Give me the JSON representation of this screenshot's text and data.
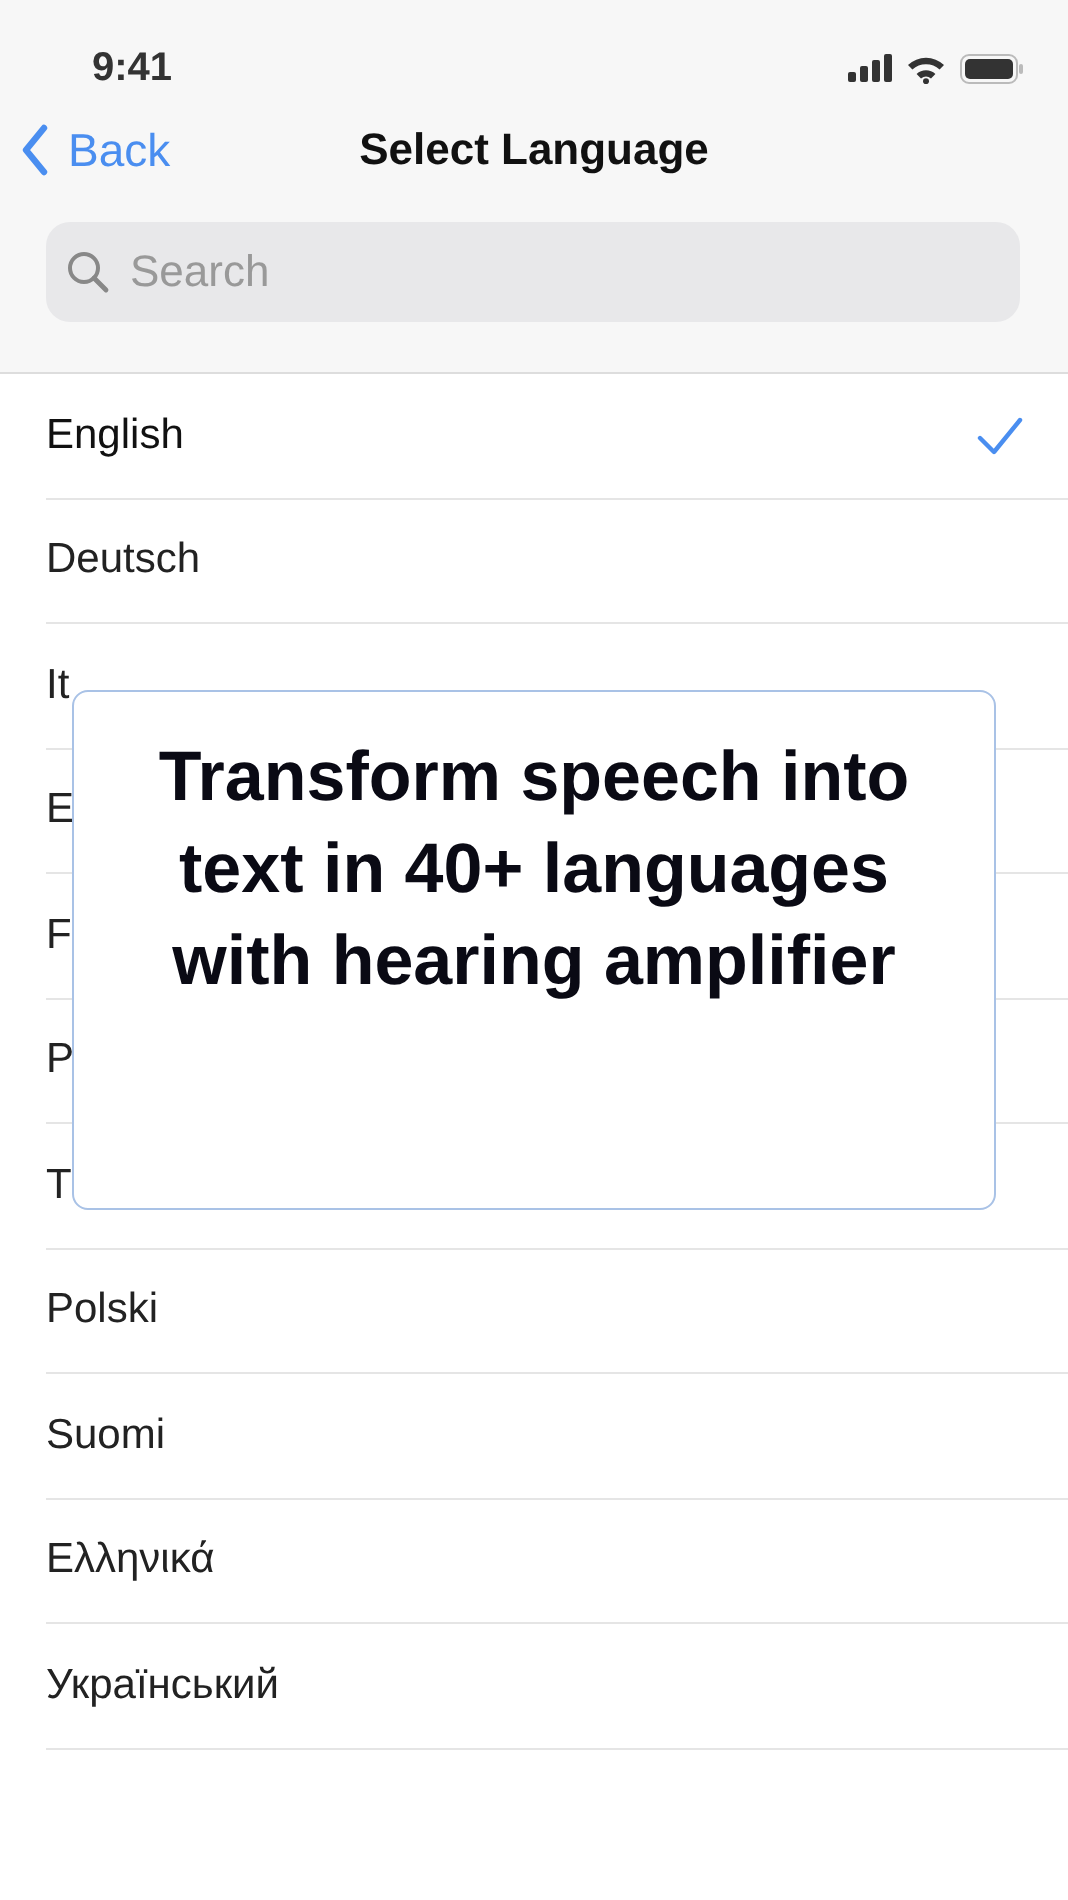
{
  "status_bar": {
    "time": "9:41"
  },
  "nav": {
    "back": "Back",
    "title": "Select Language"
  },
  "search": {
    "placeholder": "Search"
  },
  "languages": [
    {
      "name": "English",
      "selected": true
    },
    {
      "name": "Deutsch",
      "selected": false
    },
    {
      "name": "It",
      "selected": false
    },
    {
      "name": "E",
      "selected": false
    },
    {
      "name": "F",
      "selected": false
    },
    {
      "name": "P",
      "selected": false
    },
    {
      "name": "T",
      "selected": false
    },
    {
      "name": "Polski",
      "selected": false
    },
    {
      "name": "Suomi",
      "selected": false
    },
    {
      "name": "Ελληνικά",
      "selected": false
    },
    {
      "name": "Український",
      "selected": false
    }
  ],
  "overlay": {
    "headline": "Transform speech into text in 40+ languages with hearing amplifier"
  }
}
